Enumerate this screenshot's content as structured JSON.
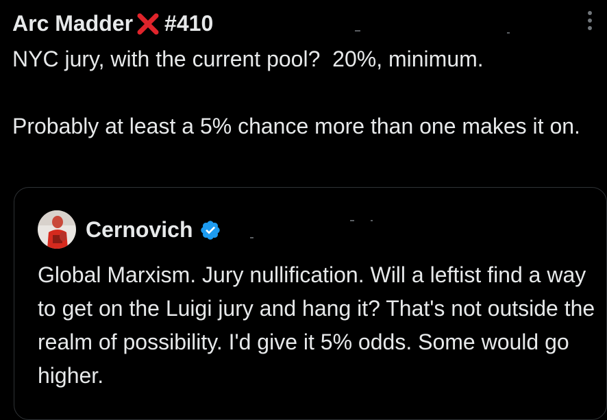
{
  "tweet": {
    "display_name": "Arc Madder",
    "name_suffix": "#410",
    "name_emoji_icon": "red-x-mark-icon",
    "more_icon": "more-options-icon",
    "text": "NYC jury, with the current pool?  20%, minimum.\n\nProbably at least a 5% chance more than one makes it on."
  },
  "quote": {
    "author_name": "Cernovich",
    "verified_icon": "verified-badge-icon",
    "text": "Global Marxism. Jury nullification. Will a leftist find a way to get on the Luigi jury and hang it? That's not outside the realm of possibility. I'd give it 5% odds. Some would go higher."
  },
  "colors": {
    "background": "#000000",
    "text": "#e7e9ea",
    "muted": "#71767b",
    "border": "#2f3336",
    "verified_blue": "#1d9bf0",
    "x_red": "#e0242b"
  }
}
